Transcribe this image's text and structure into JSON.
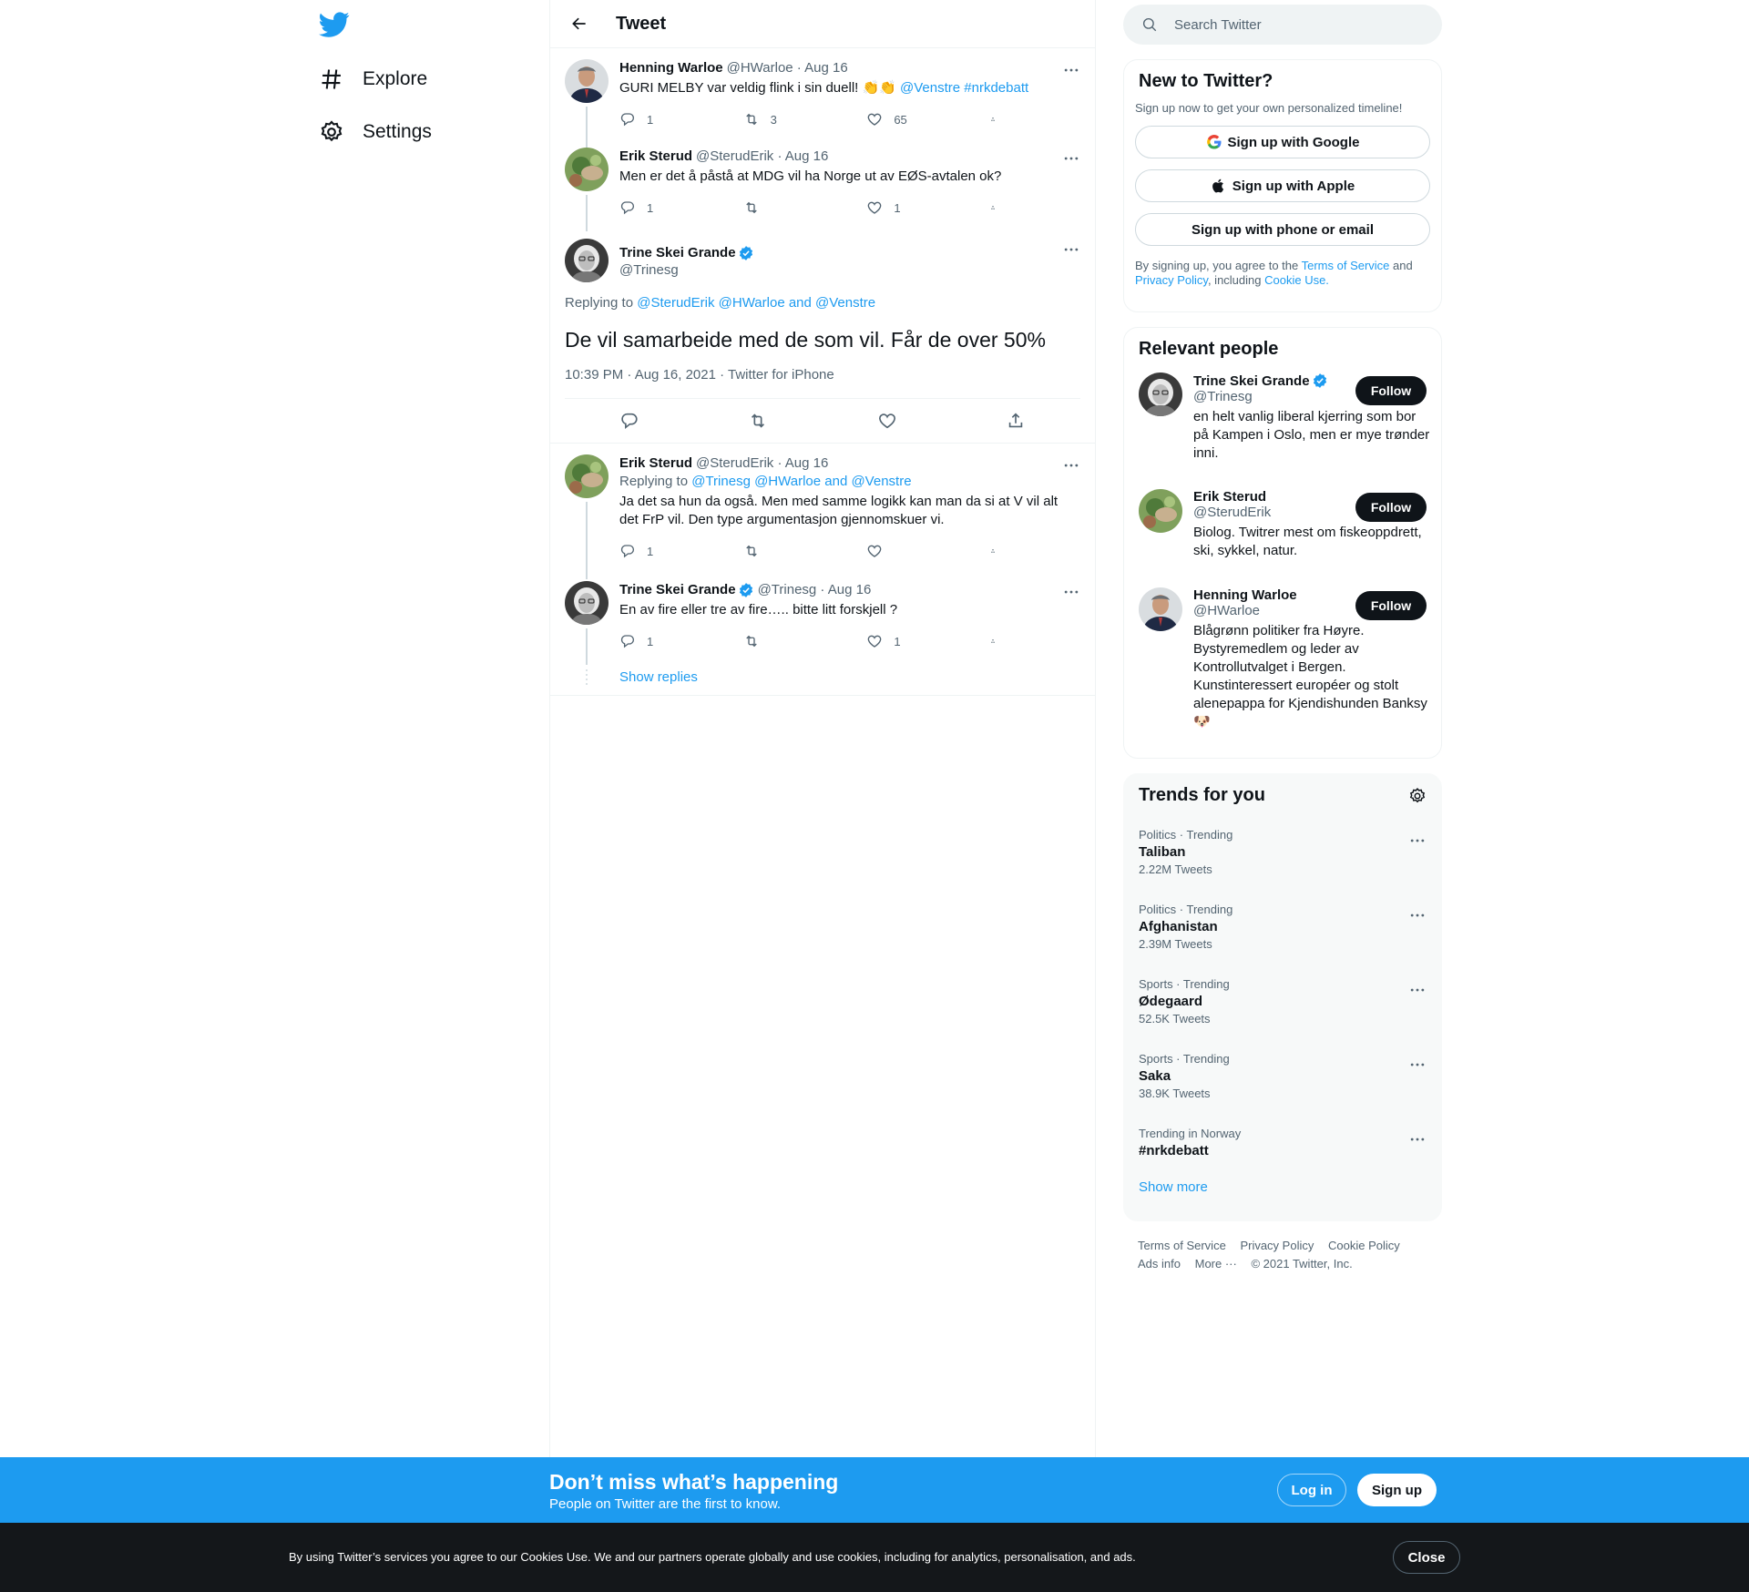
{
  "nav": {
    "explore": "Explore",
    "settings": "Settings"
  },
  "header": {
    "title": "Tweet"
  },
  "tweets": [
    {
      "name": "Henning Warloe",
      "meta": "@HWarloe · Aug 16",
      "text_prefix": "GURI MELBY var veldig flink i sin duell! 👏👏 ",
      "text_links": "@Venstre #nrkdebatt",
      "replies": "1",
      "retweets": "3",
      "likes": "65"
    },
    {
      "name": "Erik Sterud",
      "meta": "@SterudErik · Aug 16",
      "text": "Men er det å påstå at MDG vil ha Norge ut av EØS-avtalen ok?",
      "replies": "1",
      "retweets": "",
      "likes": "1"
    }
  ],
  "focus": {
    "name": "Trine Skei Grande",
    "handle": "@Trinesg",
    "reply_label": "Replying to",
    "reply_to": "@SterudErik @HWarloe and @Venstre",
    "text": "De vil samarbeide med de som vil. Får de over 50%",
    "time": "10:39 PM · Aug 16, 2021 · Twitter for iPhone"
  },
  "replies": [
    {
      "name": "Erik Sterud",
      "meta": "@SterudErik · Aug 16",
      "reply_label": "Replying to",
      "reply_to": "@Trinesg @HWarloe and @Venstre",
      "text": "Ja det sa hun da også. Men med samme logikk kan man da si at V vil alt det FrP vil. Den type argumentasjon gjennomskuer vi.",
      "replies": "1",
      "retweets": "",
      "likes": ""
    },
    {
      "name": "Trine Skei Grande",
      "meta": "@Trinesg · Aug 16",
      "text": "En av fire eller tre av fire….. bitte litt forskjell ?",
      "replies": "1",
      "retweets": "",
      "likes": "1"
    }
  ],
  "show_replies": "Show replies",
  "search": {
    "placeholder": "Search Twitter"
  },
  "signup_card": {
    "title": "New to Twitter?",
    "subtitle": "Sign up now to get your own personalized timeline!",
    "google": "Sign up with Google",
    "apple": "Sign up with Apple",
    "phone": "Sign up with phone or email",
    "legal_1": "By signing up, you agree to the ",
    "tos": "Terms of Service",
    "legal_2": " and ",
    "privacy": "Privacy Policy",
    "legal_3": ", including ",
    "cookie": "Cookie Use."
  },
  "people": {
    "title": "Relevant people",
    "follow": "Follow",
    "items": [
      {
        "name": "Trine Skei Grande",
        "handle": "@Trinesg",
        "bio": "en helt vanlig liberal kjerring som bor på Kampen i Oslo, men er mye trønder inni."
      },
      {
        "name": "Erik Sterud",
        "handle": "@SterudErik",
        "bio": "Biolog. Twitrer mest om fiskeoppdrett, ski, sykkel, natur."
      },
      {
        "name": "Henning Warloe",
        "handle": "@HWarloe",
        "bio": "Blågrønn politiker fra Høyre. Bystyremedlem og leder av Kontrollutvalget i Bergen. Kunstinteressert européer og stolt alenepappa for Kjendishunden Banksy 🐶"
      }
    ]
  },
  "trends": {
    "title": "Trends for you",
    "items": [
      {
        "category": "Politics · Trending",
        "name": "Taliban",
        "count": "2.22M Tweets"
      },
      {
        "category": "Politics · Trending",
        "name": "Afghanistan",
        "count": "2.39M Tweets"
      },
      {
        "category": "Sports · Trending",
        "name": "Ødegaard",
        "count": "52.5K Tweets"
      },
      {
        "category": "Sports · Trending",
        "name": "Saka",
        "count": "38.9K Tweets"
      },
      {
        "category": "Trending in Norway",
        "name": "#nrkdebatt",
        "count": ""
      }
    ],
    "show_more": "Show more"
  },
  "footer": {
    "tos": "Terms of Service",
    "privacy": "Privacy Policy",
    "cookie": "Cookie Policy",
    "ads": "Ads info",
    "more": "More ···",
    "copyright": "© 2021 Twitter, Inc."
  },
  "signup_bar": {
    "title": "Don’t miss what’s happening",
    "subtitle": "People on Twitter are the first to know.",
    "login": "Log in",
    "signup": "Sign up"
  },
  "cookie_bar": {
    "text": "By using Twitter’s services you agree to our Cookies Use. We and our partners operate globally and use cookies, including for analytics, personalisation, and ads.",
    "close": "Close"
  },
  "colors": {
    "accent": "#1d9bf0",
    "text": "#0f1419",
    "muted": "#536471"
  }
}
